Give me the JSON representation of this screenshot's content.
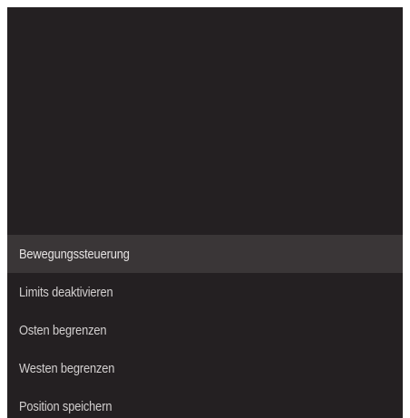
{
  "menu": {
    "selected_index": 0,
    "items": [
      {
        "label": "Bewegungssteuerung"
      },
      {
        "label": "Limits deaktivieren"
      },
      {
        "label": "Osten begrenzen"
      },
      {
        "label": "Westen begrenzen"
      },
      {
        "label": "Position speichern"
      }
    ]
  },
  "colors": {
    "background": "#242022",
    "selected_background": "#3a3637",
    "text": "#d2cfcf"
  }
}
